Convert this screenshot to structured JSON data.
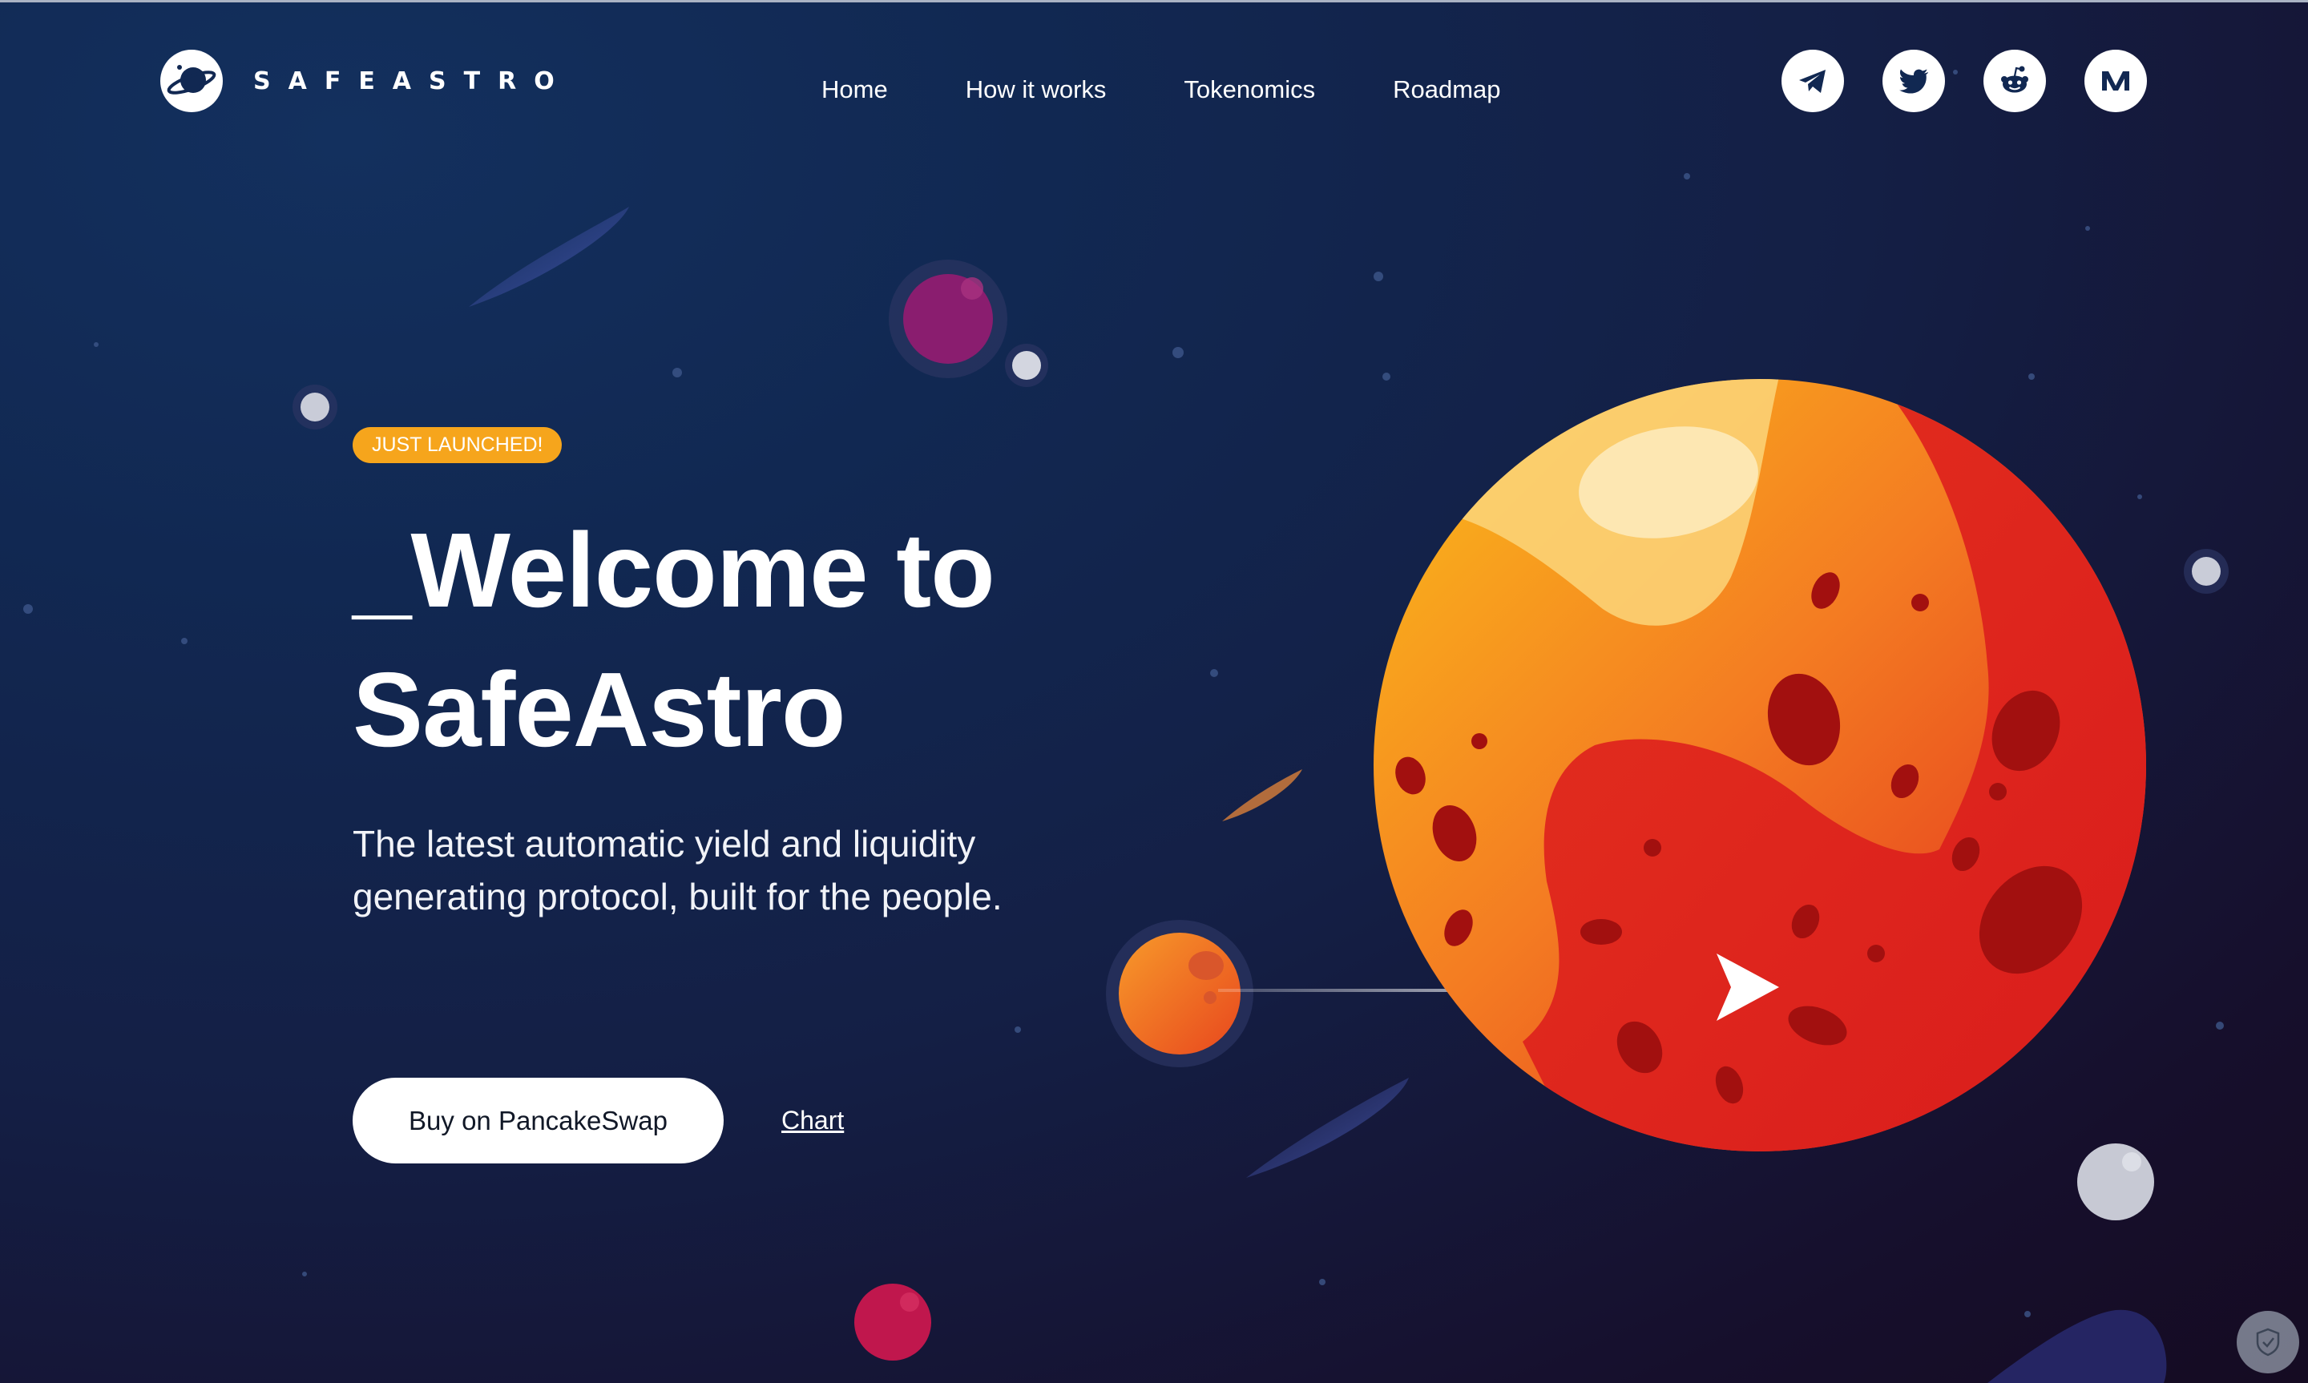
{
  "header": {
    "logo_text": "SAFEASTRO",
    "nav": [
      "Home",
      "How it works",
      "Tokenomics",
      "Roadmap"
    ],
    "socials": [
      {
        "icon": "telegram-icon"
      },
      {
        "icon": "twitter-icon"
      },
      {
        "icon": "reddit-icon"
      },
      {
        "icon": "medium-icon"
      }
    ]
  },
  "hero": {
    "badge": "JUST LAUNCHED!",
    "headline_line1": "_Welcome to",
    "headline_line2": "SafeAstro",
    "tagline": "The latest automatic yield and liquidity generating protocol, built for the people.",
    "buy_button": "Buy on PancakeSwap",
    "chart_link": "Chart"
  },
  "colors": {
    "background": "#112852",
    "badge": "#f6a51c",
    "planet_orange": "#f9a41f",
    "planet_red": "#e32a1c",
    "text": "#ffffff"
  }
}
